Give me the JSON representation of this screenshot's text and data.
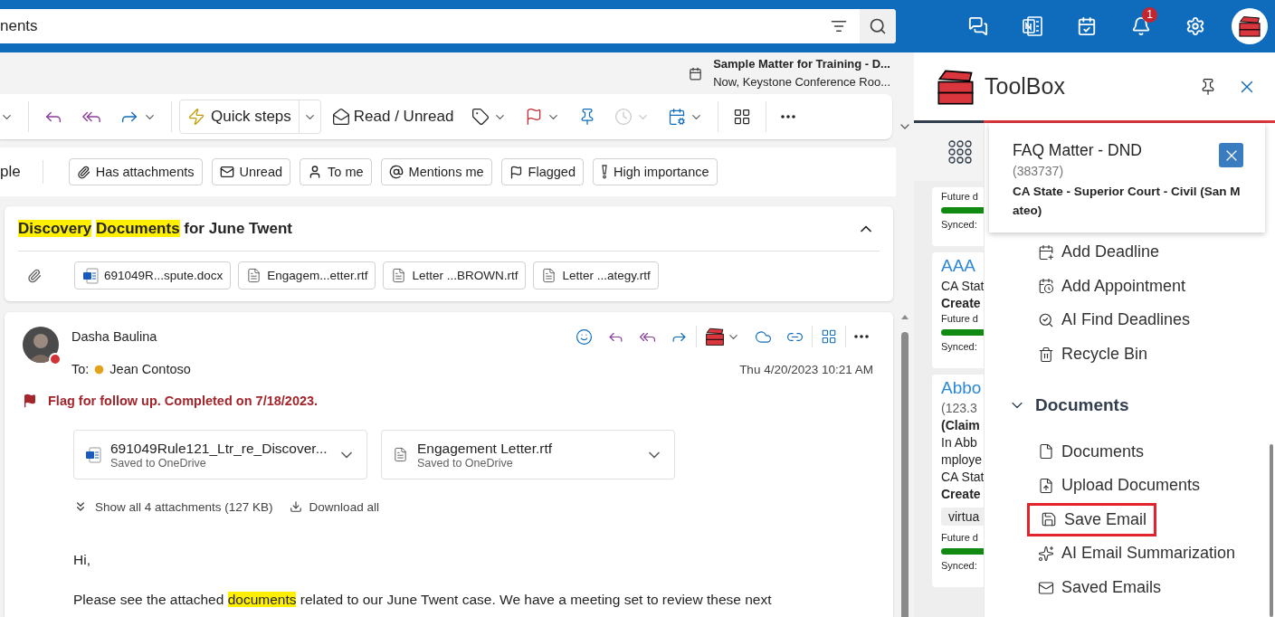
{
  "top_bar": {
    "search": {
      "value": "nents"
    },
    "notifications": {
      "badge": "1"
    }
  },
  "reminder": {
    "title": "Sample Matter for Training - D...",
    "detail": "Now, Keystone Conference Roo..."
  },
  "toolbar": {
    "quick_steps": "Quick steps",
    "read_unread": "Read / Unread"
  },
  "filters": {
    "label": "ple",
    "chips": [
      "Has attachments",
      "Unread",
      "To me",
      "Mentions me",
      "Flagged",
      "High importance"
    ]
  },
  "conversation": {
    "title": [
      {
        "text": "Discovery",
        "highlight": true
      },
      {
        "text": "Documents",
        "highlight": true
      },
      {
        "text": "for June Twent",
        "highlight": false
      }
    ],
    "attachments": [
      {
        "name": "691049R...spute.docx",
        "kind": "word"
      },
      {
        "name": "Engagem...etter.rtf",
        "kind": "text"
      },
      {
        "name": "Letter ...BROWN.rtf",
        "kind": "text"
      },
      {
        "name": "Letter ...ategy.rtf",
        "kind": "text"
      }
    ]
  },
  "message": {
    "sender": "Dasha Baulina",
    "to_label": "To:",
    "recipient": "Jean Contoso",
    "date": "Thu 4/20/2023 10:21 AM",
    "flag": "Flag for follow up. Completed on 7/18/2023.",
    "attachments": [
      {
        "name": "691049Rule121_Ltr_re_Discover...",
        "status": "Saved to OneDrive",
        "kind": "word"
      },
      {
        "name": "Engagement Letter.rtf",
        "status": "Saved to OneDrive",
        "kind": "text"
      }
    ],
    "show_all": "Show all 4 attachments (127 KB)",
    "download_all": "Download all",
    "greeting": "Hi,",
    "body": [
      {
        "text": "Please see the attached",
        "highlight": false
      },
      {
        "text": "documents",
        "highlight": true
      },
      {
        "text": "related to our June Twent case. We have a meeting set to review these next",
        "highlight": false
      }
    ]
  },
  "toolbox": {
    "title": "ToolBox",
    "matters": [
      {
        "lines": [
          {
            "kind": "small",
            "text": "Future d"
          },
          {
            "kind": "bar",
            "level": 1
          },
          {
            "kind": "small",
            "text": "Synced:"
          }
        ]
      },
      {
        "lines": [
          {
            "kind": "link",
            "text": "AAA"
          },
          {
            "kind": "text",
            "text": "CA Stat"
          },
          {
            "kind": "bold",
            "text": "Create"
          },
          {
            "kind": "small",
            "text": "Future d"
          },
          {
            "kind": "bar",
            "level": 1
          },
          {
            "kind": "small",
            "text": "Synced:"
          }
        ]
      },
      {
        "lines": [
          {
            "kind": "link",
            "text": "Abbo"
          },
          {
            "kind": "muted",
            "text": "(123.3"
          },
          {
            "kind": "bold",
            "text": "(Claim"
          },
          {
            "kind": "text",
            "text": "In Abb"
          },
          {
            "kind": "text",
            "text": "mploye"
          },
          {
            "kind": "text",
            "text": "CA Stat"
          },
          {
            "kind": "bold",
            "text": "Create"
          },
          {
            "kind": "chip",
            "text": "virtua"
          },
          {
            "kind": "small",
            "text": "Future d"
          },
          {
            "kind": "bar",
            "level": 1
          },
          {
            "kind": "small",
            "text": "Synced:"
          }
        ]
      }
    ],
    "menu": [
      {
        "kind": "item",
        "label": "Add Deadline",
        "highlighted": false
      },
      {
        "kind": "item",
        "label": "Add Appointment",
        "highlighted": false
      },
      {
        "kind": "item",
        "label": "AI Find Deadlines",
        "highlighted": false
      },
      {
        "kind": "item",
        "label": "Recycle Bin",
        "highlighted": false
      },
      {
        "kind": "section",
        "label": "Documents",
        "expanded": true
      },
      {
        "kind": "item",
        "label": "Documents",
        "highlighted": false
      },
      {
        "kind": "item",
        "label": "Upload Documents",
        "highlighted": false
      },
      {
        "kind": "item",
        "label": "Save Email",
        "highlighted": true
      },
      {
        "kind": "item",
        "label": "AI Email Summarization",
        "highlighted": false
      },
      {
        "kind": "item",
        "label": "Saved Emails",
        "highlighted": false
      }
    ],
    "popup": {
      "title": "FAQ Matter - DND",
      "number": "(383737)",
      "court": "CA State - Superior Court - Civil (San Mateo)"
    }
  }
}
